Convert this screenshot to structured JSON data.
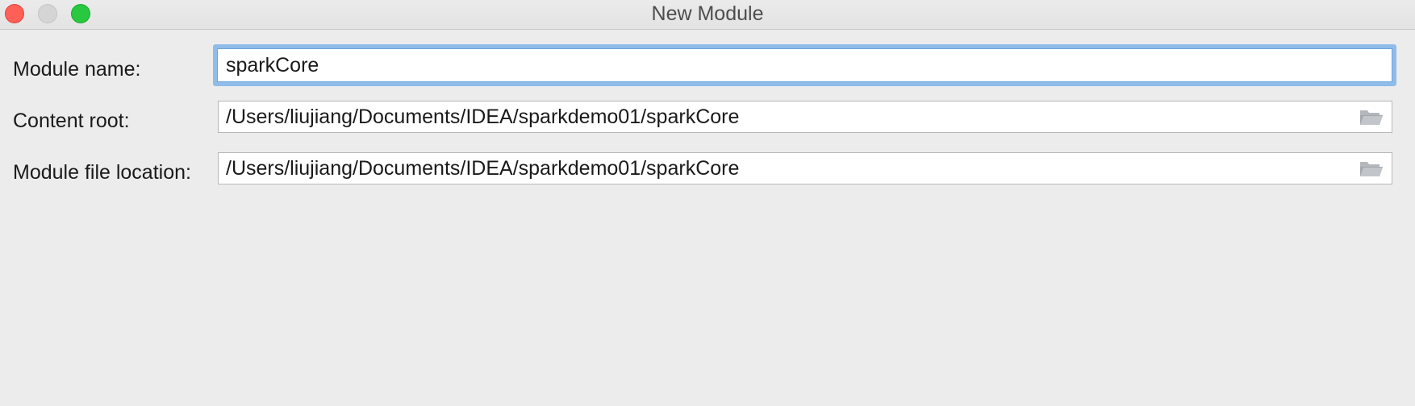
{
  "window": {
    "title": "New Module"
  },
  "form": {
    "module_name": {
      "label": "Module name:",
      "value": "sparkCore"
    },
    "content_root": {
      "label": "Content root:",
      "value": "/Users/liujiang/Documents/IDEA/sparkdemo01/sparkCore",
      "browse_icon": "folder-open-icon"
    },
    "module_file_location": {
      "label": "Module file location:",
      "value": "/Users/liujiang/Documents/IDEA/sparkdemo01/sparkCore",
      "browse_icon": "folder-open-icon"
    }
  },
  "colors": {
    "focus_ring": "#8fbcea",
    "close": "#fe5f57",
    "zoom": "#28c840",
    "minimize_inactive": "#d5d5d5"
  }
}
